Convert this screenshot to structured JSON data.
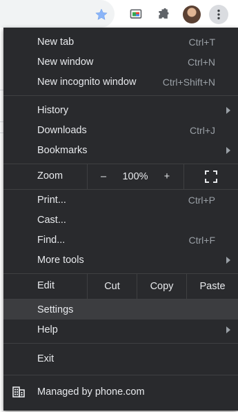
{
  "toolbar": {
    "icons": [
      "star-icon",
      "cast-icon",
      "puzzle-icon",
      "avatar",
      "kebab-icon"
    ]
  },
  "menu": {
    "group1": [
      {
        "label": "New tab",
        "shortcut": "Ctrl+T"
      },
      {
        "label": "New window",
        "shortcut": "Ctrl+N"
      },
      {
        "label": "New incognito window",
        "shortcut": "Ctrl+Shift+N"
      }
    ],
    "group2": [
      {
        "label": "History",
        "shortcut": ""
      },
      {
        "label": "Downloads",
        "shortcut": "Ctrl+J"
      },
      {
        "label": "Bookmarks",
        "shortcut": ""
      }
    ],
    "zoom": {
      "label": "Zoom",
      "minus": "–",
      "value": "100%",
      "plus": "+"
    },
    "group3": [
      {
        "label": "Print...",
        "shortcut": "Ctrl+P"
      },
      {
        "label": "Cast...",
        "shortcut": ""
      },
      {
        "label": "Find...",
        "shortcut": "Ctrl+F"
      },
      {
        "label": "More tools",
        "shortcut": ""
      }
    ],
    "edit": {
      "label": "Edit",
      "cut": "Cut",
      "copy": "Copy",
      "paste": "Paste"
    },
    "group4": [
      {
        "label": "Settings",
        "shortcut": ""
      },
      {
        "label": "Help",
        "shortcut": ""
      }
    ],
    "exit": {
      "label": "Exit"
    },
    "managed": {
      "label": "Managed by phone.com"
    }
  },
  "colors": {
    "menu_bg": "#292a2d",
    "text": "#e8eaed",
    "shortcut": "#9aa0a6",
    "hover": "#3c3d40",
    "star": "#8ab4f8"
  }
}
